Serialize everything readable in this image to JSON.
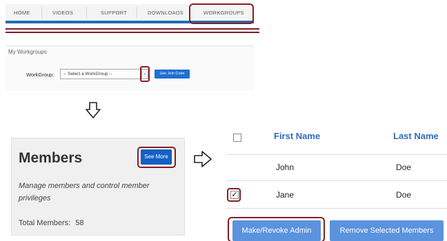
{
  "nav": {
    "items": [
      "HOME",
      "VIDEOS",
      "SUPPORT",
      "DOWNLOADS",
      "WORKGROUPS"
    ]
  },
  "workgroups": {
    "title": "My Workgroups",
    "label": "WorkGroup:",
    "select_value": "-- Select a WorkGroup --",
    "join_button": "Use Join Code"
  },
  "members_card": {
    "title": "Members",
    "see_more": "See More",
    "description": "Manage members and control member privileges",
    "total_label": "Total Members:",
    "total_value": "58"
  },
  "member_table": {
    "headers": [
      "First Name",
      "Last Name"
    ],
    "rows": [
      {
        "first": "John",
        "last": "Doe",
        "checked": false
      },
      {
        "first": "Jane",
        "last": "Doe",
        "checked": true
      }
    ],
    "buttons": {
      "admin": "Make/Revoke Admin",
      "remove": "Remove Selected Members"
    }
  },
  "colors": {
    "nav_underline": "#1f6fb3",
    "primary_button": "#1460c4",
    "table_button": "#5b93df",
    "header_text": "#2d6cbf",
    "highlight": "#8b1c24"
  },
  "icons": {
    "arrow_down": "arrow-down-icon",
    "arrow_right": "arrow-right-icon",
    "dropdown": "chevron-down-icon",
    "checkbox": "checkbox-icon"
  }
}
